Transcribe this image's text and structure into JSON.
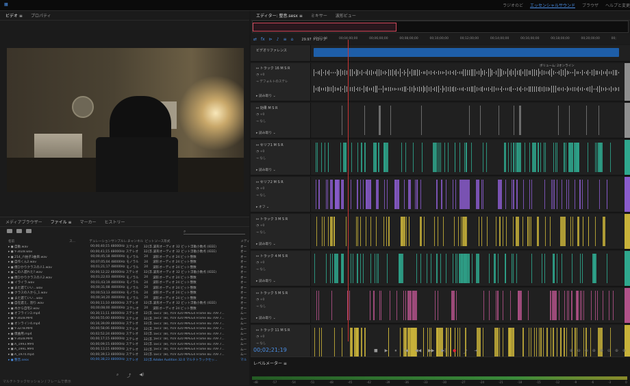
{
  "topbar": {
    "workspaces": [
      "ラジオのど",
      "エッセンシャルサウンド",
      "ブラウザ",
      "ヘルプと変更"
    ],
    "active_workspace": 1
  },
  "video_panel": {
    "tabs": [
      "ビデオ ≡",
      "プロパティ"
    ]
  },
  "media_browser": {
    "tabs": [
      "メディアブラウザー",
      "ファイル ≡",
      "マーカー",
      "ヒストリー"
    ],
    "search_placeholder": "",
    "columns": [
      "名前",
      "ス...",
      "デュレーション",
      "サンプルレ...",
      "チャンネル",
      "ビット...",
      "ソース形式",
      "メディ"
    ],
    "rows": [
      [
        "自動.wav",
        "00;00;40;15",
        "48000Hz",
        "ステレオ",
        "32(浮...",
        "波形オーディオ 32 ビット浮動小数点 (IEEE)",
        "オー"
      ],
      [
        "Y-3028.wav",
        "00;00;41;15",
        "48000Hz",
        "ステレオ",
        "32(浮...",
        "波形オーディオ 32 ビット浮動小数点 (IEEE)",
        "オー"
      ],
      [
        "214_六拍子3曲目.wav",
        "00;00;45;18",
        "48000Hz",
        "モノラル",
        "24",
        "波形オーディオ 24 ビット整数",
        "オー"
      ],
      [
        "自作くん2.wav",
        "00;07;05;04",
        "48000Hz",
        "モノラル",
        "24",
        "波形オーディオ 24 ビット整数",
        "オー"
      ],
      [
        "僕ひかりクラスの人1.wav",
        "00;01;21;17",
        "48000Hz",
        "モノラル",
        "24",
        "波形オーディオ 24 ビット整数",
        "オー"
      ],
      [
        "この人遅れた?.wav",
        "00;00;12;22",
        "48000Hz",
        "ステレオ",
        "32(浮...",
        "波形オーディオ 32 ビット浮動小数点 (IEEE)",
        "オー"
      ],
      [
        "僕ひかりクラスの人2.wav",
        "00;01;22;03",
        "48000Hz",
        "モノラル",
        "24",
        "波形オーディオ 24 ビット整数",
        "オー"
      ],
      [
        "イライラ.wav",
        "00;01;43;19",
        "48000Hz",
        "モノラル",
        "24",
        "波形オーディオ 24 ビット整数",
        "オー"
      ],
      [
        "また遅ていい...wav",
        "00;00;31;08",
        "48000Hz",
        "モノラル",
        "24",
        "波形オーディオ 24 ビット整数",
        "オー"
      ],
      [
        "クラスの人から_1.wav",
        "00;00;53;13",
        "48000Hz",
        "モノラル",
        "24",
        "波形オーディオ 24 ビット整数",
        "オー"
      ],
      [
        "また遅ていい...wav",
        "00;00;34;20",
        "48000Hz",
        "モノラル",
        "24",
        "波形オーディオ 24 ビット整数",
        "オー"
      ],
      [
        "自在遅え、割り.wav",
        "00;00;11;10",
        "48000Hz",
        "ステレオ",
        "32(浮...",
        "波形オーディオ 32 ビット浮動小数点 (IEEE)",
        "オー"
      ],
      [
        "木から自宅2.wav",
        "00;00;08;00",
        "48000Hz",
        "ステレオ",
        "24",
        "波形オーディオ 24 ビット整数",
        "オー"
      ],
      [
        "オフライン2.mp4",
        "00;30;11;11",
        "48000Hz",
        "ステレオ",
        "32(浮...",
        "'avc1' (B), YUV 420 MPEG4 Frame Bu 709 7...",
        "ムー"
      ],
      [
        "Y-3028.MP4",
        "00;00;55;00",
        "48000Hz",
        "ステレオ",
        "32(浮...",
        "'avc1' (B), YUV 420 MPEG4 Frame Bu 709 7...",
        "ムー"
      ],
      [
        "オンライン4.mp4",
        "00;16;39;09",
        "48000Hz",
        "ステレオ",
        "32(浮...",
        "'avc1' (B), YUV 420 MPEG4 Frame Bu 709 7...",
        "ムー"
      ],
      [
        "Y-3278.MP4",
        "00;00;58;06",
        "48000Hz",
        "ステレオ",
        "32(浮...",
        "'avc1' (B), YUV 420 MPEG4 Frame Bu 709 7...",
        "ムー"
      ],
      [
        "僕曲用.mp4",
        "00;02;52;24",
        "48000Hz",
        "ステレオ",
        "32(浮...",
        "'avc1' (B), YUV 420 MPEG4 Frame Bu 709 7...",
        "ムー"
      ],
      [
        "Y-3028.MP4",
        "00;00;17;15",
        "48000Hz",
        "ステレオ",
        "32(浮...",
        "'avc1' (B), YUV 420 MPEG4 Frame Bu 709 7...",
        "ムー"
      ],
      [
        "A_1993.MP4",
        "00;00;09;15",
        "48000Hz",
        "ステレオ",
        "32(浮...",
        "'avc1' (B), YUV 420 MPEG4 Frame Bu 709 7...",
        "ムー"
      ],
      [
        "A_1991.MP4",
        "00;00;13;15",
        "48000Hz",
        "ステレオ",
        "32(浮...",
        "'avc1' (B), YUV 420 MPEG4 Frame Bu 709 7...",
        "ムー"
      ],
      [
        "A_1974.mp4",
        "00;00;39;13",
        "48000Hz",
        "ステレオ",
        "32(浮...",
        "'avc1' (B), YUV 420 MPEG4 Frame Bu 709 7...",
        "ムー"
      ],
      [
        "整音.sesx",
        "00;00;38;23",
        "48000Hz",
        "ステレオ",
        "32(浮...",
        "Adobe Audition 32.0 マルチトラックセッ...",
        "マル"
      ]
    ],
    "selected_row": 22,
    "status": "マルチトラックセッション / フレームで表示"
  },
  "editor": {
    "tabs": [
      "エディター: 整音.sesx ≡",
      "ミキサー",
      "波形ビュー"
    ],
    "toolbar": [
      "⇄",
      "fx",
      "⊳",
      "♪",
      "≡",
      "⌂"
    ],
    "drop_label": "29.97 ドロップ",
    "ruler": [
      "00;02;00",
      "00;04;00;00",
      "00;06;00;00",
      "00;08;00;00",
      "00;10;00;00",
      "00;12;00;00",
      "00;14;00;00",
      "00;16;00;00",
      "00;18;00;00",
      "00;20;00;00",
      "00;"
    ],
    "video_reference": "ビデオリファレンス",
    "tracks": [
      {
        "name": "トラック 16",
        "vol": "+0",
        "out": "デフォルトのステレ",
        "read": "読み取り",
        "lane": "ボリューム: 2オンライン"
      },
      {
        "name": "効果",
        "vol": "+0",
        "out": "なし",
        "read": "読み取り"
      },
      {
        "name": "セリフ1",
        "vol": "+0",
        "out": "なし",
        "read": "読み取り"
      },
      {
        "name": "セリフ2",
        "vol": "+0",
        "out": "なし",
        "read": "オフ"
      },
      {
        "name": "トラック 3",
        "vol": "+0",
        "out": "なし",
        "read": "読み取り"
      },
      {
        "name": "トラック 4",
        "vol": "+0",
        "out": "なし",
        "read": "読み取り"
      },
      {
        "name": "トラック 5",
        "vol": "+0",
        "out": "なし",
        "read": "読み取り"
      },
      {
        "name": "トラック 11",
        "vol": "+0",
        "out": "なし",
        "read": ""
      }
    ],
    "timecode": "00;02;21;19",
    "transport": [
      "■",
      "▶",
      "⏸",
      "|◀",
      "◀◀",
      "▶▶",
      "▶|",
      "●",
      "⤴",
      "⇥"
    ],
    "zoom": [
      "⊕",
      "⊖",
      "⊖",
      "⊕",
      "⊕",
      "⊖",
      "⊕",
      "⊕"
    ]
  },
  "level_meter": {
    "title": "レベルメーター ≡",
    "scale": [
      "-dB",
      "-57",
      "-54",
      "-51",
      "-48",
      "-45",
      "-42",
      "-39",
      "-36",
      "-33",
      "-30",
      "-27",
      "-24",
      "-21",
      "-18",
      "-15",
      "-12",
      "-9",
      "-6",
      "-3",
      "0"
    ]
  },
  "colors": {
    "accent": "#4a8fe6",
    "teal": "#2fa88e",
    "purple": "#8a5ccc",
    "yellow": "#c8b23a",
    "pink": "#b3528a",
    "gray": "#8f8f8f"
  }
}
